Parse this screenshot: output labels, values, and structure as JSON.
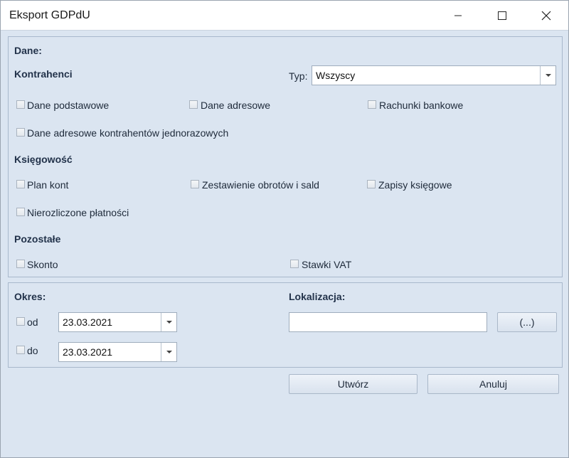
{
  "window": {
    "title": "Eksport GDPdU"
  },
  "dane": {
    "header": "Dane:",
    "kontrahenci": {
      "header": "Kontrahenci",
      "typ_label": "Typ:",
      "typ_value": "Wszyscy",
      "options": [
        "Dane podstawowe",
        "Dane adresowe",
        "Rachunki bankowe",
        "Dane adresowe kontrahentów jednorazowych"
      ]
    },
    "ksiegowosc": {
      "header": "Księgowość",
      "options": [
        "Plan kont",
        "Zestawienie obrotów i sald",
        "Zapisy księgowe",
        "Nierozliczone płatności"
      ]
    },
    "pozostale": {
      "header": "Pozostałe",
      "options": [
        "Skonto",
        "Stawki VAT"
      ]
    }
  },
  "okres": {
    "header": "Okres:",
    "od_label": "od",
    "od_value": "23.03.2021",
    "do_label": "do",
    "do_value": "23.03.2021"
  },
  "lokalizacja": {
    "header": "Lokalizacja:",
    "value": "",
    "browse_label": "(...)"
  },
  "actions": {
    "create_label": "Utwórz",
    "cancel_label": "Anuluj"
  }
}
